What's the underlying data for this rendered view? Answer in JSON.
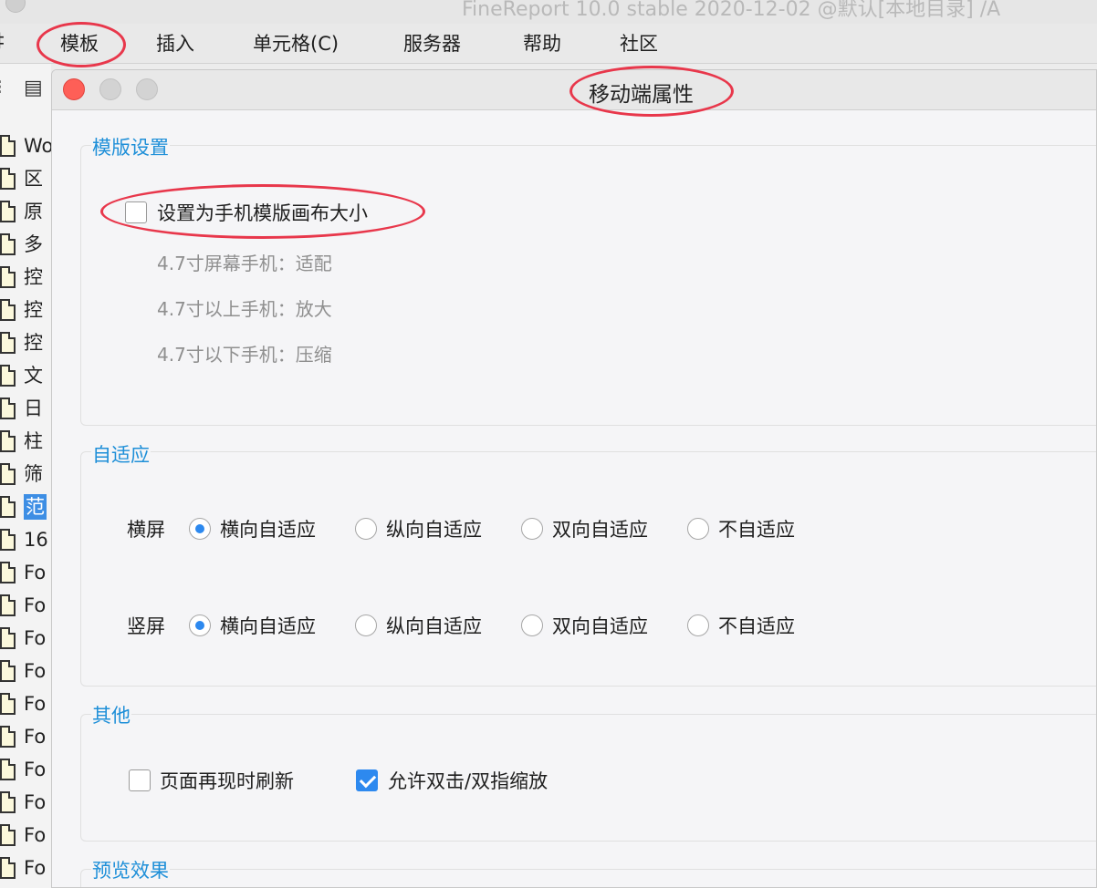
{
  "app": {
    "title": "FineReport 10.0 stable 2020-12-02 @默认[本地目录] /A"
  },
  "menubar": {
    "items": [
      {
        "label": "‡"
      },
      {
        "label": "模板"
      },
      {
        "label": "插入"
      },
      {
        "label": "单元格(C)"
      },
      {
        "label": "服务器"
      },
      {
        "label": "帮助"
      },
      {
        "label": "社区"
      }
    ]
  },
  "tree": {
    "items": [
      {
        "label": "Wo"
      },
      {
        "label": "区"
      },
      {
        "label": "原"
      },
      {
        "label": "多"
      },
      {
        "label": "控"
      },
      {
        "label": "控"
      },
      {
        "label": "控"
      },
      {
        "label": "文"
      },
      {
        "label": "日"
      },
      {
        "label": "柱"
      },
      {
        "label": "筛"
      },
      {
        "label": "范"
      },
      {
        "label": "16"
      },
      {
        "label": "Fo"
      },
      {
        "label": "Fo"
      },
      {
        "label": "Fo"
      },
      {
        "label": "Fo"
      },
      {
        "label": "Fo"
      },
      {
        "label": "Fo"
      },
      {
        "label": "Fo"
      },
      {
        "label": "Fo"
      },
      {
        "label": "Fo"
      },
      {
        "label": "Fo"
      }
    ],
    "selected_label": "范"
  },
  "dialog": {
    "title": "移动端属性",
    "template_settings": {
      "title": "模版设置",
      "phone_canvas_label": "设置为手机模版画布大小",
      "phone_canvas_checked": false,
      "hints": [
        "4.7寸屏幕手机：适配",
        "4.7寸以上手机：放大",
        "4.7寸以下手机：压缩"
      ]
    },
    "adaptive": {
      "title": "自适应",
      "options": [
        "横向自适应",
        "纵向自适应",
        "双向自适应",
        "不自适应"
      ],
      "landscape": {
        "label": "横屏",
        "selected": "横向自适应"
      },
      "portrait": {
        "label": "竖屏",
        "selected": "横向自适应"
      }
    },
    "other": {
      "title": "其他",
      "refresh_label": "页面再现时刷新",
      "refresh_checked": false,
      "zoom_label": "允许双击/双指缩放",
      "zoom_checked": true
    },
    "preview": {
      "title": "预览效果"
    }
  },
  "colors": {
    "accent": "#2d89ef",
    "group_title": "#1e8fd8",
    "highlight_ring": "#e8374b",
    "selection": "#3d8ee4"
  }
}
